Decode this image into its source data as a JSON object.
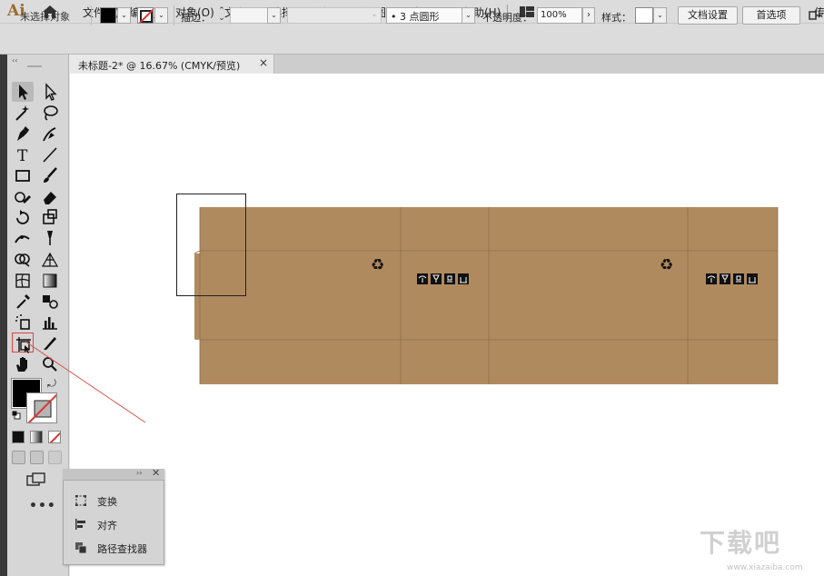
{
  "app": {
    "logo": "Ai"
  },
  "menu": [
    "文件(F)",
    "编辑(E)",
    "对象(O)",
    "文字(T)",
    "选择(S)",
    "效果(C)",
    "视图(V)",
    "窗口(W)",
    "帮助(H)"
  ],
  "menu_overflow": "传",
  "control_bar": {
    "selection_label": "未选择对象",
    "stroke_label": "描边：",
    "brush_value": "•  3 点圆形",
    "opacity_label": "不透明度：",
    "opacity_value": "100%",
    "style_label": "样式：",
    "doc_setup": "文档设置",
    "preferences": "首选项"
  },
  "document_tab": {
    "title": "未标题-2* @ 16.67% (CMYK/预览)",
    "close": "×"
  },
  "tools": [
    "selection-tool",
    "direct-selection-tool",
    "magic-wand-tool",
    "lasso-tool",
    "pen-tool",
    "curvature-tool",
    "type-tool",
    "line-tool",
    "rectangle-tool",
    "paintbrush-tool",
    "shaper-tool",
    "eraser-tool",
    "rotate-tool",
    "scale-tool",
    "width-tool",
    "puppet-warp-tool",
    "shape-builder-tool",
    "perspective-grid-tool",
    "mesh-tool",
    "gradient-tool",
    "eyedropper-tool",
    "blend-tool",
    "symbol-sprayer-tool",
    "column-graph-tool",
    "artboard-tool",
    "slice-tool",
    "hand-tool",
    "zoom-tool"
  ],
  "panel": {
    "items": [
      {
        "label": "变换",
        "icon": "transform-icon"
      },
      {
        "label": "对齐",
        "icon": "align-icon"
      },
      {
        "label": "路径查找器",
        "icon": "pathfinder-icon"
      }
    ]
  },
  "colors": {
    "box": "#b08a5f",
    "fold_line": "#8e6f4a",
    "pointer": "#d9534f"
  },
  "watermark": {
    "text": "下载吧",
    "url": "www.xiazaiba.com"
  }
}
